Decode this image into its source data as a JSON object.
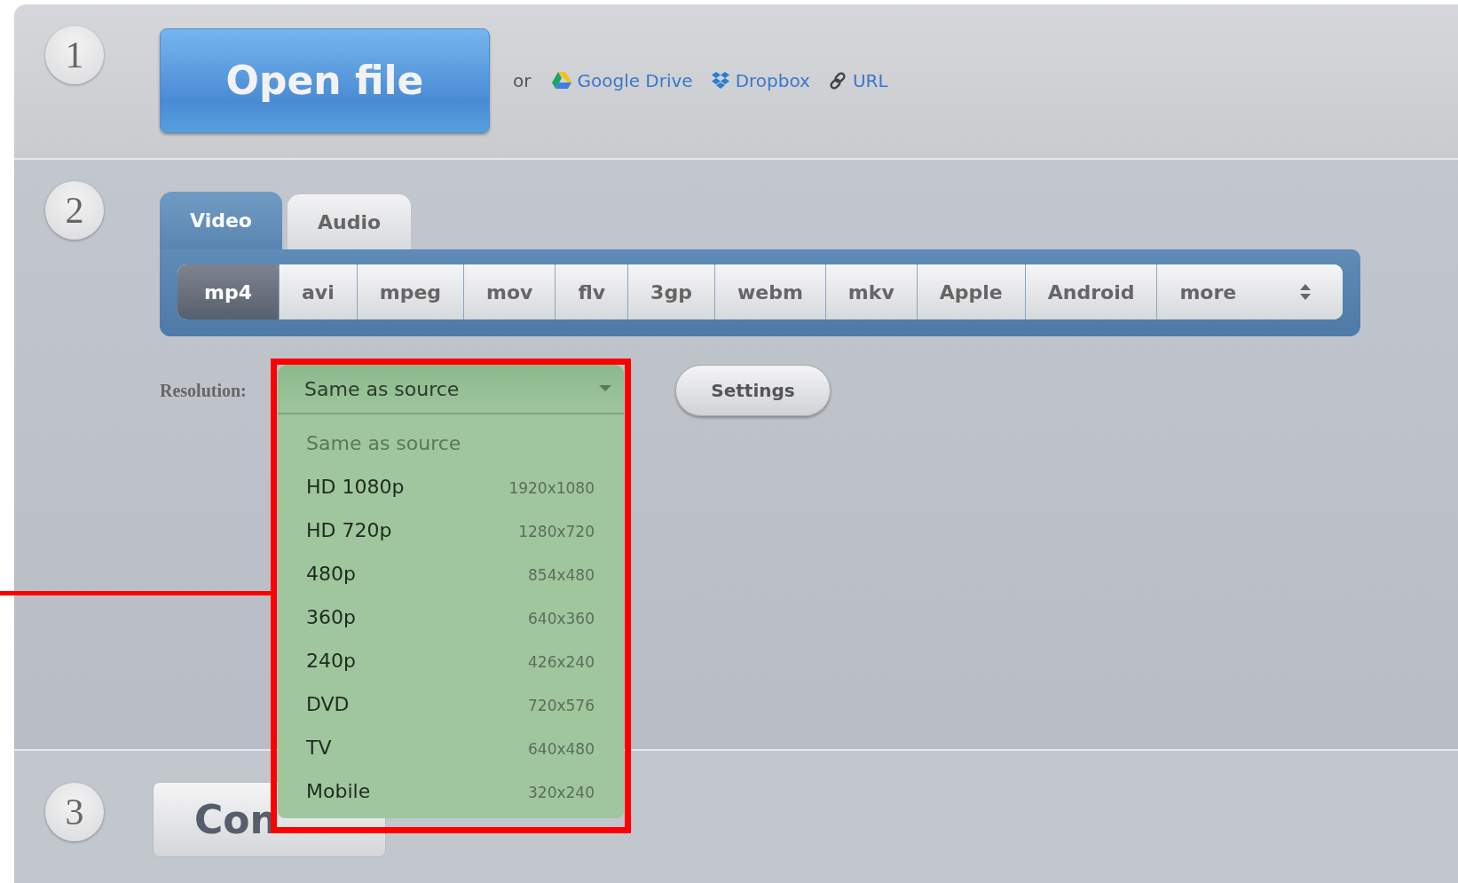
{
  "step_1": {
    "number": "1",
    "open_button": "Open file",
    "or_text": "or",
    "sources": [
      {
        "kind": "drive",
        "label": "Google Drive"
      },
      {
        "kind": "dropbox",
        "label": "Dropbox"
      },
      {
        "kind": "link",
        "label": "URL"
      }
    ]
  },
  "step_2": {
    "number": "2",
    "tabs": [
      {
        "label": "Video",
        "selected": true
      },
      {
        "label": "Audio",
        "selected": false
      }
    ],
    "formats": [
      {
        "label": "mp4",
        "selected": true
      },
      {
        "label": "avi",
        "selected": false
      },
      {
        "label": "mpeg",
        "selected": false
      },
      {
        "label": "mov",
        "selected": false
      },
      {
        "label": "flv",
        "selected": false
      },
      {
        "label": "3gp",
        "selected": false
      },
      {
        "label": "webm",
        "selected": false
      },
      {
        "label": "mkv",
        "selected": false
      },
      {
        "label": "Apple",
        "selected": false
      },
      {
        "label": "Android",
        "selected": false
      }
    ],
    "more_select": {
      "value": "more"
    },
    "resolution": {
      "label": "Resolution:",
      "value": "Same as source",
      "expanded": true,
      "options": [
        {
          "name": "Same as source",
          "disabled": true
        },
        {
          "name": "HD 1080p",
          "size": "1920x1080",
          "disabled": false
        },
        {
          "name": "HD 720p",
          "size": "1280x720",
          "disabled": false
        },
        {
          "name": "480p",
          "size": "854x480",
          "disabled": false
        },
        {
          "name": "360p",
          "size": "640x360",
          "disabled": false
        },
        {
          "name": "240p",
          "size": "426x240",
          "disabled": false
        },
        {
          "name": "DVD",
          "size": "720x576",
          "disabled": false
        },
        {
          "name": "TV",
          "size": "640x480",
          "disabled": false
        },
        {
          "name": "Mobile",
          "size": "320x240",
          "disabled": false
        }
      ]
    },
    "settings_button": "Settings"
  },
  "step_3": {
    "number": "3",
    "convert_button": "Con"
  }
}
